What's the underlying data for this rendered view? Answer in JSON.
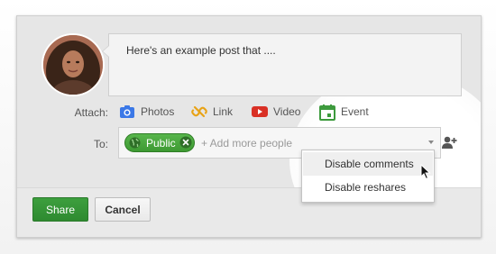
{
  "post": {
    "text": "Here's an example post that ...."
  },
  "attach": {
    "label": "Attach:",
    "items": [
      {
        "label": "Photos",
        "icon": "camera-icon",
        "color": "#3b78e7"
      },
      {
        "label": "Link",
        "icon": "link-icon",
        "color": "#e8a317"
      },
      {
        "label": "Video",
        "icon": "youtube-icon",
        "color": "#d93025"
      },
      {
        "label": "Event",
        "icon": "calendar-icon",
        "color": "#3d9a3d"
      }
    ]
  },
  "to": {
    "label": "To:",
    "chip_label": "Public",
    "chip_color": "#4aa63f",
    "add_more_placeholder": "+ Add more people"
  },
  "menu": {
    "items": [
      "Disable comments",
      "Disable reshares"
    ]
  },
  "buttons": {
    "share": "Share",
    "cancel": "Cancel"
  }
}
